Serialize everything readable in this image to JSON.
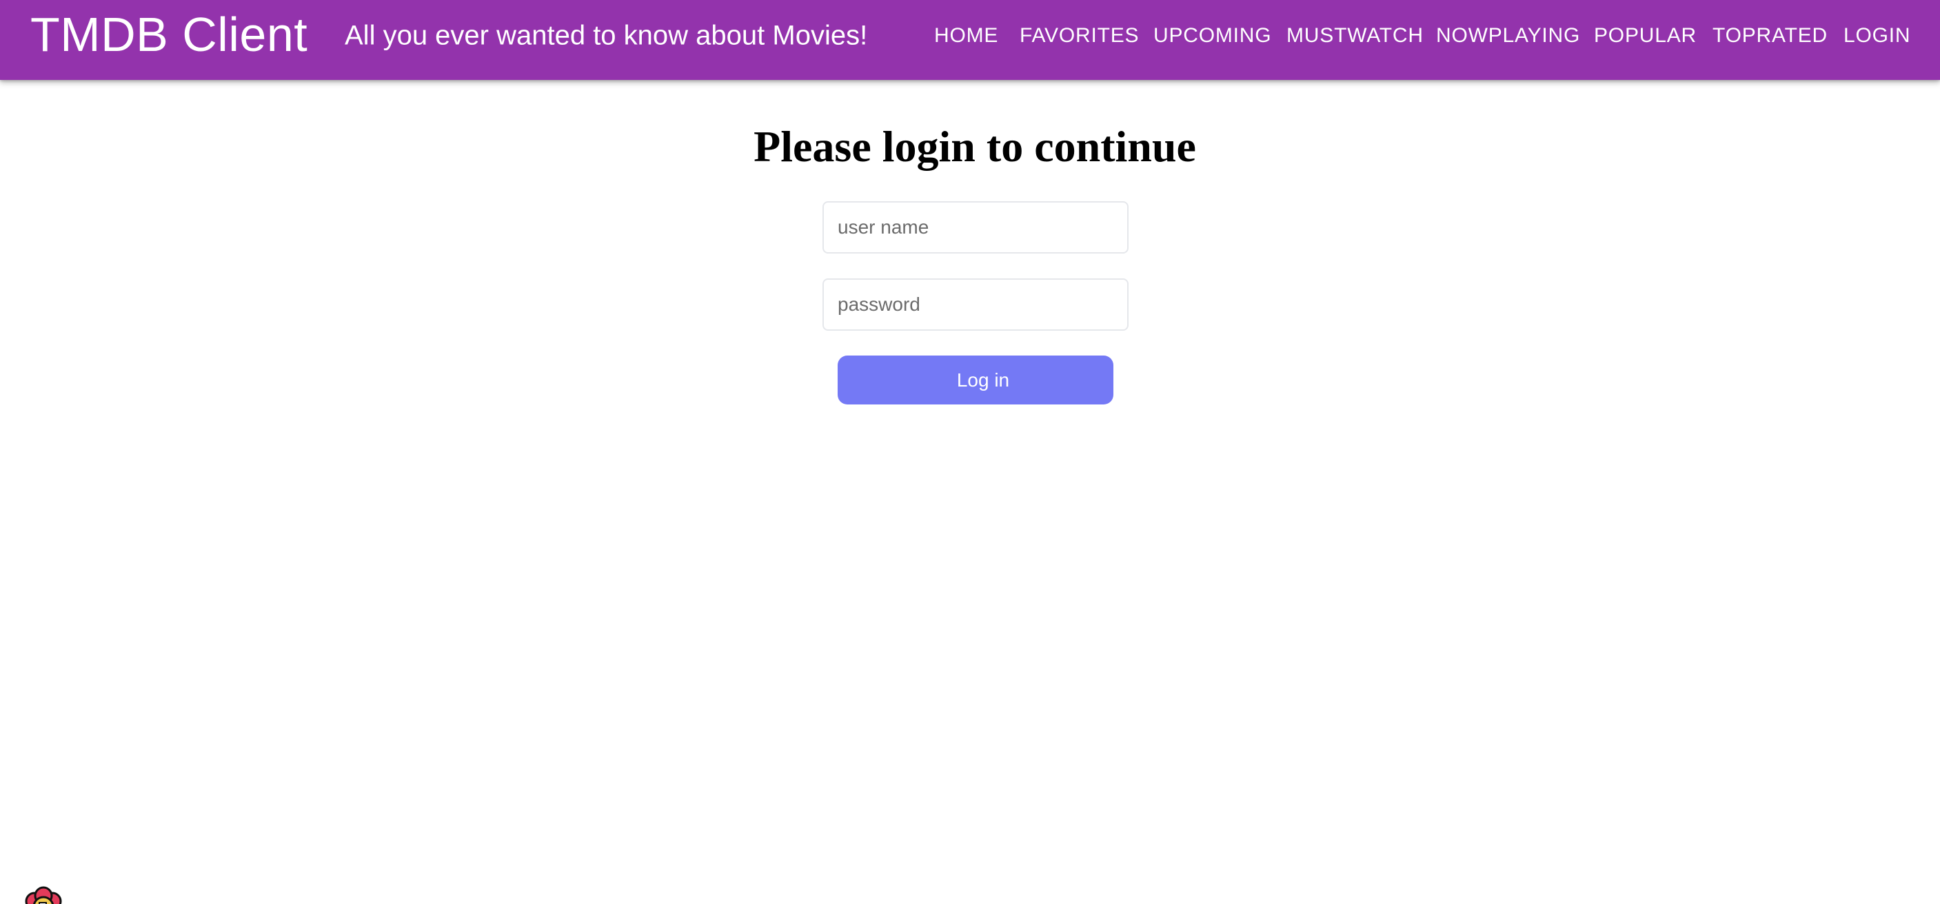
{
  "header": {
    "brand": "TMDB Client",
    "tagline": "All you ever wanted to know about Movies!",
    "background_color": "#9333ac",
    "nav_items": [
      {
        "label": "HOME"
      },
      {
        "label": "FAVORITES"
      },
      {
        "label": "UPCOMING"
      },
      {
        "label": "MUSTWATCH"
      },
      {
        "label": "NOWPLAYING"
      },
      {
        "label": "POPULAR"
      },
      {
        "label": "TOPRATED"
      },
      {
        "label": "LOGIN"
      }
    ]
  },
  "login": {
    "heading": "Please login to continue",
    "username_placeholder": "user name",
    "username_value": "",
    "password_placeholder": "password",
    "password_value": "",
    "submit_label": "Log in",
    "button_color": "#7479f5"
  },
  "corner_icon": "react-query-devtools-flower-icon"
}
